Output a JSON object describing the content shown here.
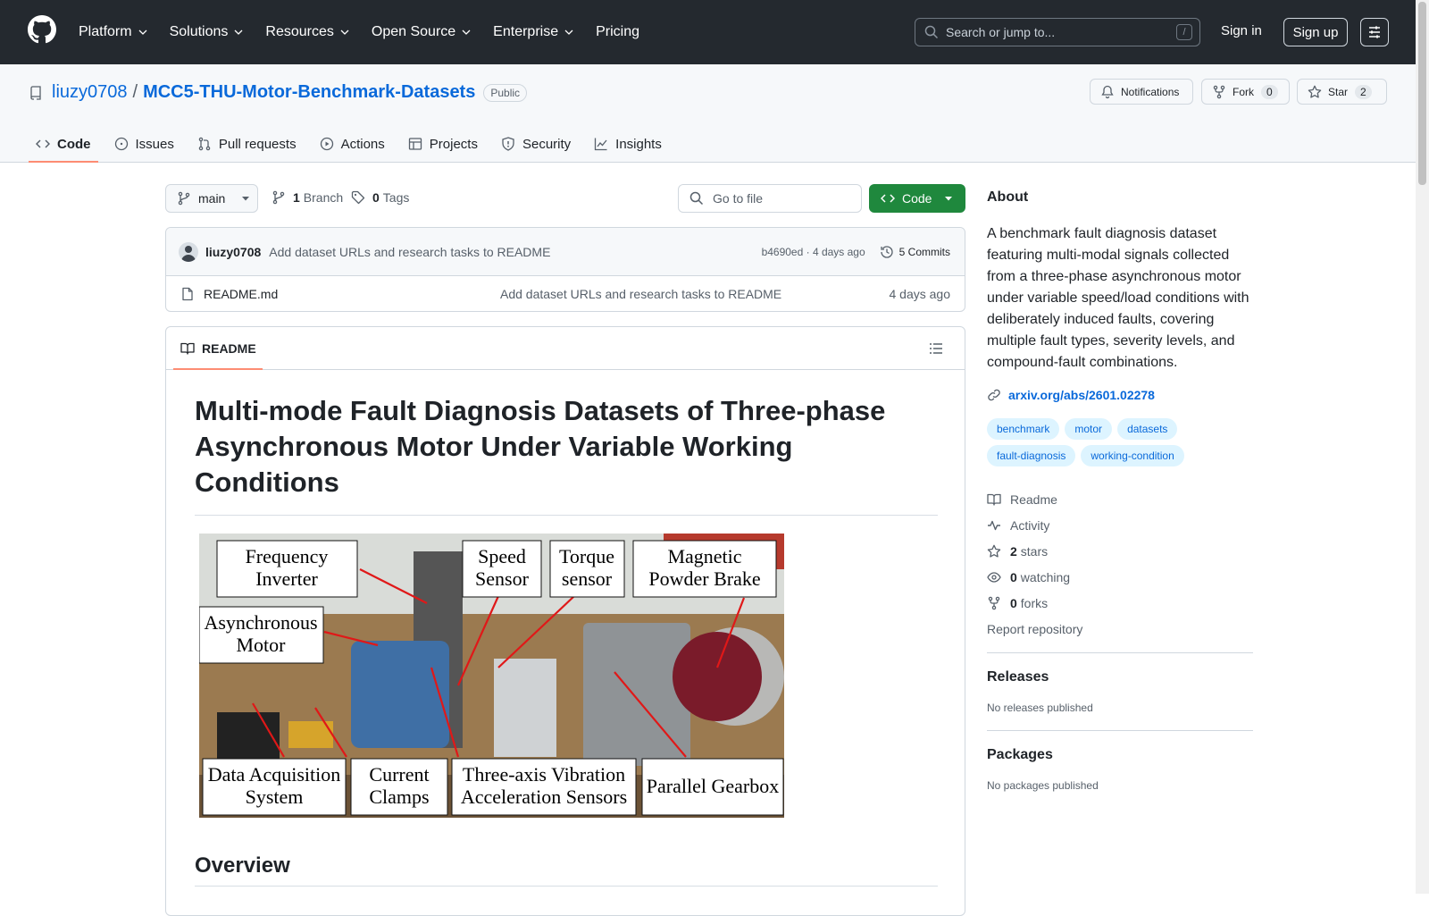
{
  "topnav": {
    "items": [
      {
        "label": "Platform",
        "dropdown": true
      },
      {
        "label": "Solutions",
        "dropdown": true
      },
      {
        "label": "Resources",
        "dropdown": true
      },
      {
        "label": "Open Source",
        "dropdown": true
      },
      {
        "label": "Enterprise",
        "dropdown": true
      },
      {
        "label": "Pricing",
        "dropdown": false
      }
    ],
    "search_placeholder": "Search or jump to...",
    "search_shortcut": "/",
    "signin": "Sign in",
    "signup": "Sign up"
  },
  "repo": {
    "owner": "liuzy0708",
    "separator": "/",
    "name": "MCC5-THU-Motor-Benchmark-Datasets",
    "visibility": "Public",
    "notifications_label": "Notifications",
    "fork_label": "Fork",
    "fork_count": "0",
    "star_label": "Star",
    "star_count": "2"
  },
  "tabs": [
    {
      "label": "Code",
      "icon": "code-icon",
      "active": true
    },
    {
      "label": "Issues",
      "icon": "issue-icon"
    },
    {
      "label": "Pull requests",
      "icon": "pull-request-icon"
    },
    {
      "label": "Actions",
      "icon": "play-icon"
    },
    {
      "label": "Projects",
      "icon": "table-icon"
    },
    {
      "label": "Security",
      "icon": "shield-icon"
    },
    {
      "label": "Insights",
      "icon": "graph-icon"
    }
  ],
  "toolbar": {
    "branch": "main",
    "branch_count": "1",
    "branch_label": "Branch",
    "tag_count": "0",
    "tag_label": "Tags",
    "goto_placeholder": "Go to file",
    "code_label": "Code"
  },
  "commit": {
    "author": "liuzy0708",
    "message": "Add dataset URLs and research tasks to README",
    "hash": "b4690ed",
    "time": "4 days ago",
    "hash_time": "b4690ed · 4 days ago",
    "commits_label": "5 Commits"
  },
  "files": [
    {
      "name": "README.md",
      "message": "Add dataset URLs and research tasks to README",
      "date": "4 days ago"
    }
  ],
  "readme": {
    "tab_label": "README",
    "title": "Multi-mode Fault Diagnosis Datasets of Three-phase Asynchronous Motor Under Variable Working Conditions",
    "figure_labels": {
      "frequency_inverter": "Frequency Inverter",
      "speed_sensor": "Speed Sensor",
      "torque_sensor": "Torque sensor",
      "magnetic_brake": "Magnetic Powder Brake",
      "async_motor": "Asynchronous Motor",
      "daq": "Data Acquisition System",
      "current_clamps": "Current Clamps",
      "vibration": "Three-axis Vibration Acceleration Sensors",
      "gearbox": "Parallel Gearbox"
    },
    "overview_heading": "Overview"
  },
  "about": {
    "heading": "About",
    "description": "A benchmark fault diagnosis dataset featuring multi-modal signals collected from a three-phase asynchronous motor under variable speed/load conditions with deliberately induced faults, covering multiple fault types, severity levels, and compound-fault combinations.",
    "link": "arxiv.org/abs/2601.02278",
    "topics": [
      "benchmark",
      "motor",
      "datasets",
      "fault-diagnosis",
      "working-condition"
    ],
    "readme": "Readme",
    "activity": "Activity",
    "stars_count": "2",
    "stars_label": "stars",
    "watching_count": "0",
    "watching_label": "watching",
    "forks_count": "0",
    "forks_label": "forks",
    "report": "Report repository"
  },
  "releases": {
    "heading": "Releases",
    "empty": "No releases published"
  },
  "packages": {
    "heading": "Packages",
    "empty": "No packages published"
  },
  "colors": {
    "header_bg": "#24292f",
    "link": "#0969da",
    "green": "#1f883d",
    "tab_underline": "#fd8c73"
  }
}
